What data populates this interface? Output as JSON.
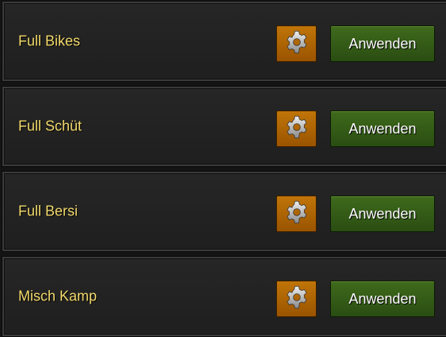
{
  "presets": [
    {
      "name": "Full Bikes",
      "settings_icon": "gear-icon",
      "apply_label": "Anwenden"
    },
    {
      "name": "Full Schüt",
      "settings_icon": "gear-icon",
      "apply_label": "Anwenden"
    },
    {
      "name": "Full Bersi",
      "settings_icon": "gear-icon",
      "apply_label": "Anwenden"
    },
    {
      "name": "Misch Kamp",
      "settings_icon": "gear-icon",
      "apply_label": "Anwenden"
    }
  ],
  "colors": {
    "label": "#f3d96b",
    "settings_button": "#b06a04",
    "apply_button": "#355c17"
  }
}
